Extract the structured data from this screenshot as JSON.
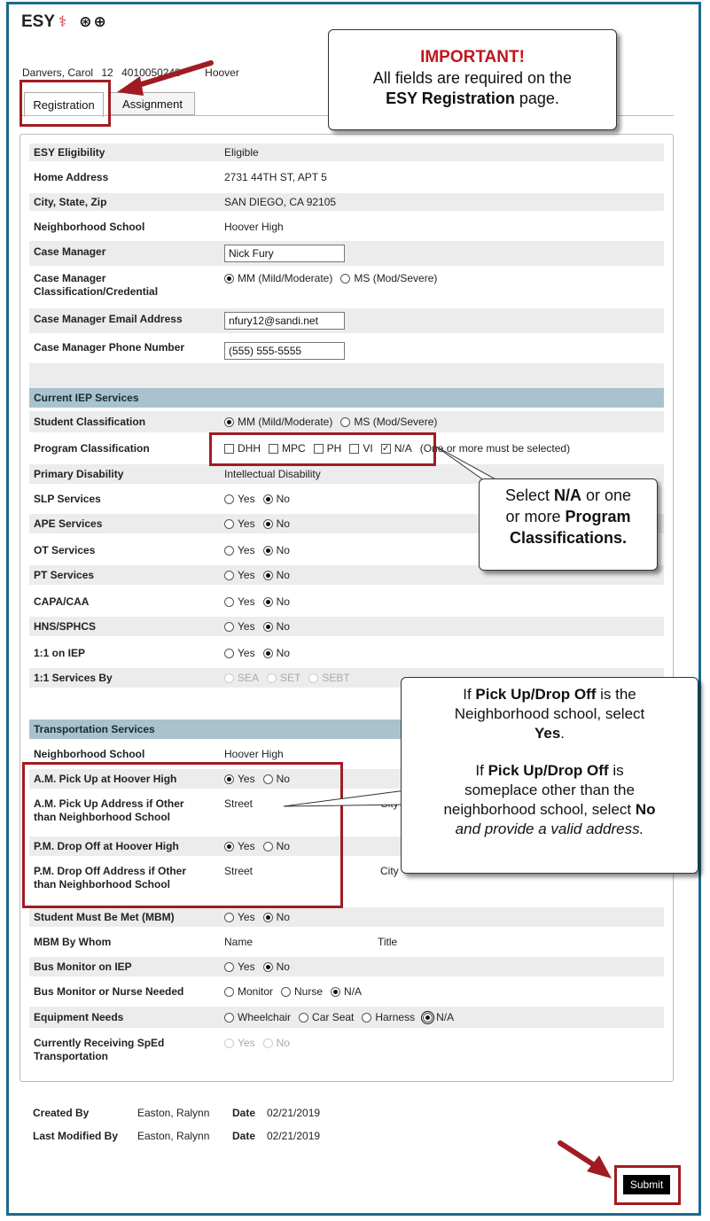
{
  "app": {
    "logo_text": "ESY",
    "tools_icons": "⊛⊕"
  },
  "student": {
    "name": "Danvers, Carol",
    "grade": "12",
    "id": "4010050248",
    "school": "Hoover"
  },
  "tabs": [
    {
      "label": "Registration"
    },
    {
      "label": "Assignment"
    }
  ],
  "callouts": {
    "important": {
      "title": "IMPORTANT!",
      "line1": "All fields are required on the",
      "line2_bold": "ESY Registration",
      "line2_rest": " page."
    },
    "program": {
      "l1a": "Select ",
      "l1b": "N/A",
      "l1c": " or one",
      "l2a": "or more ",
      "l2b": "Program",
      "l3": "Classifications."
    },
    "pickup": {
      "p1a": "If ",
      "p1b": "Pick Up/Drop Off",
      "p1c": " is the",
      "p1d": "Neighborhood school, select",
      "p1e": "Yes",
      "p1f": ".",
      "p2a": "If ",
      "p2b": "Pick Up/Drop Off",
      "p2c": " is",
      "p2d": "someplace other than the",
      "p2e": "neighborhood school, select ",
      "p2f": "No",
      "p2g": "and provide a valid address."
    }
  },
  "registration": {
    "esy_eligibility": {
      "label": "ESY Eligibility",
      "value": "Eligible"
    },
    "home_address": {
      "label": "Home Address",
      "value": "2731 44TH ST, APT 5"
    },
    "city_state_zip": {
      "label": "City, State, Zip",
      "value": "SAN DIEGO, CA 92105"
    },
    "neighborhood_school": {
      "label": "Neighborhood School",
      "value": "Hoover High"
    },
    "case_manager": {
      "label": "Case Manager",
      "value": "Nick Fury"
    },
    "cm_class": {
      "label1": "Case Manager",
      "label2": "Classification/Credential",
      "opt1": "MM (Mild/Moderate)",
      "opt2": "MS (Mod/Severe)"
    },
    "cm_email": {
      "label": "Case Manager Email Address",
      "value": "nfury12@sandi.net"
    },
    "cm_phone": {
      "label": "Case Manager Phone Number",
      "value": "(555) 555-5555"
    }
  },
  "iep": {
    "header": "Current IEP Services",
    "student_class": {
      "label": "Student Classification",
      "opt1": "MM (Mild/Moderate)",
      "opt2": "MS (Mod/Severe)"
    },
    "program_class": {
      "label": "Program Classification",
      "opts": [
        "DHH",
        "MPC",
        "PH",
        "VI",
        "N/A"
      ],
      "note": "(One or more must be selected)"
    },
    "primary_disability": {
      "label": "Primary Disability",
      "value": "Intellectual Disability"
    },
    "yes_label": "Yes",
    "no_label": "No",
    "services": [
      "SLP Services",
      "APE Services",
      "OT Services",
      "PT Services",
      "CAPA/CAA",
      "HNS/SPHCS",
      "1:1 on IEP"
    ],
    "one_on_one_by": {
      "label": "1:1 Services By",
      "opts": [
        "SEA",
        "SET",
        "SEBT"
      ]
    }
  },
  "transport": {
    "header": "Transportation Services",
    "neighborhood_school": {
      "label": "Neighborhood School",
      "value": "Hoover High"
    },
    "am_pickup": {
      "label": "A.M. Pick Up at Hoover High"
    },
    "am_address": {
      "label1": "A.M. Pick Up Address if Other",
      "label2": "than Neighborhood School",
      "street": "Street",
      "city": "City"
    },
    "pm_dropoff": {
      "label": "P.M. Drop Off at Hoover High"
    },
    "pm_address": {
      "label1": "P.M. Drop Off Address if Other",
      "label2": "than Neighborhood School",
      "street": "Street",
      "city": "City"
    },
    "must_be_met": {
      "label": "Student Must Be Met (MBM)"
    },
    "mbm_by": {
      "label": "MBM By Whom",
      "name": "Name",
      "title": "Title"
    },
    "bus_monitor": {
      "label": "Bus Monitor on IEP"
    },
    "monitor_nurse": {
      "label": "Bus Monitor or Nurse Needed",
      "opts": [
        "Monitor",
        "Nurse",
        "N/A"
      ]
    },
    "equipment": {
      "label": "Equipment Needs",
      "opts": [
        "Wheelchair",
        "Car Seat",
        "Harness",
        "N/A"
      ]
    },
    "receiving": {
      "label1": "Currently Receiving SpEd",
      "label2": "Transportation"
    }
  },
  "footer": {
    "created_by_label": "Created By",
    "created_by": "Easton, Ralynn",
    "date_label": "Date",
    "created_date": "02/21/2019",
    "modified_by_label": "Last Modified By",
    "modified_by": "Easton, Ralynn",
    "modified_date": "02/21/2019",
    "submit_label": "Submit"
  },
  "colors": {
    "frame": "#1d6a8c",
    "header_row": "#a9c3ce",
    "annotation_red": "#a01c22",
    "callout_red": "#c0161c"
  }
}
